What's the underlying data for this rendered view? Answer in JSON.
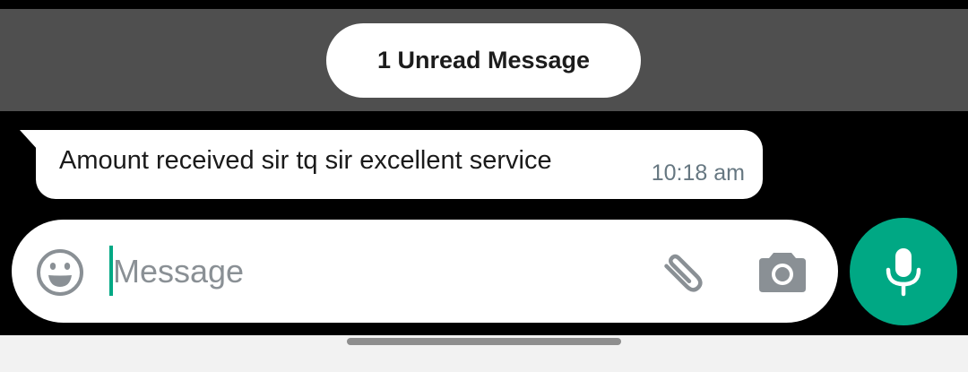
{
  "unread_banner": {
    "label": "1 Unread Message"
  },
  "messages": [
    {
      "text": "Amount received sir tq sir excellent service",
      "time": "10:18 am"
    }
  ],
  "composer": {
    "placeholder": "Message",
    "value": "",
    "icons": {
      "emoji": "emoji-icon",
      "attach": "paperclip-icon",
      "camera": "camera-icon",
      "mic": "microphone-icon"
    }
  },
  "colors": {
    "accent": "#00a884",
    "banner_background": "#4f4f4f",
    "chat_background": "#000000",
    "bubble": "#ffffff",
    "timestamp": "#667781",
    "icon_gray": "#8a9095"
  }
}
